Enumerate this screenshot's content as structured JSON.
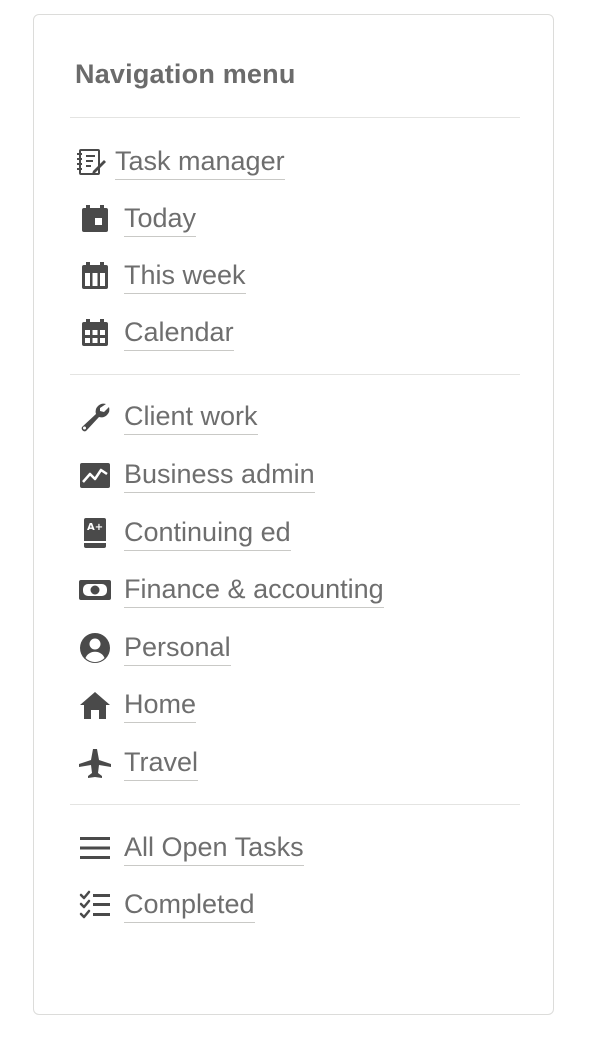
{
  "menu": {
    "title": "Navigation menu",
    "groups": [
      {
        "items": [
          {
            "label": "Task manager",
            "icon": "notebook-pen-icon"
          },
          {
            "label": "Today",
            "icon": "calendar-day-icon"
          },
          {
            "label": "This week",
            "icon": "calendar-week-icon"
          },
          {
            "label": "Calendar",
            "icon": "calendar-grid-icon"
          }
        ]
      },
      {
        "items": [
          {
            "label": "Client work",
            "icon": "wrench-icon"
          },
          {
            "label": "Business admin",
            "icon": "chart-line-icon"
          },
          {
            "label": "Continuing ed",
            "icon": "grade-book-icon"
          },
          {
            "label": "Finance & accounting",
            "icon": "money-bill-icon"
          },
          {
            "label": "Personal",
            "icon": "user-circle-icon"
          },
          {
            "label": "Home",
            "icon": "house-icon"
          },
          {
            "label": "Travel",
            "icon": "airplane-icon"
          }
        ]
      },
      {
        "items": [
          {
            "label": "All Open Tasks",
            "icon": "list-lines-icon"
          },
          {
            "label": "Completed",
            "icon": "checklist-icon"
          }
        ]
      }
    ]
  },
  "colors": {
    "text": "#6e6e6e",
    "icon": "#4a4a4a",
    "divider": "#e4e4e2",
    "border": "#dcdcda"
  }
}
